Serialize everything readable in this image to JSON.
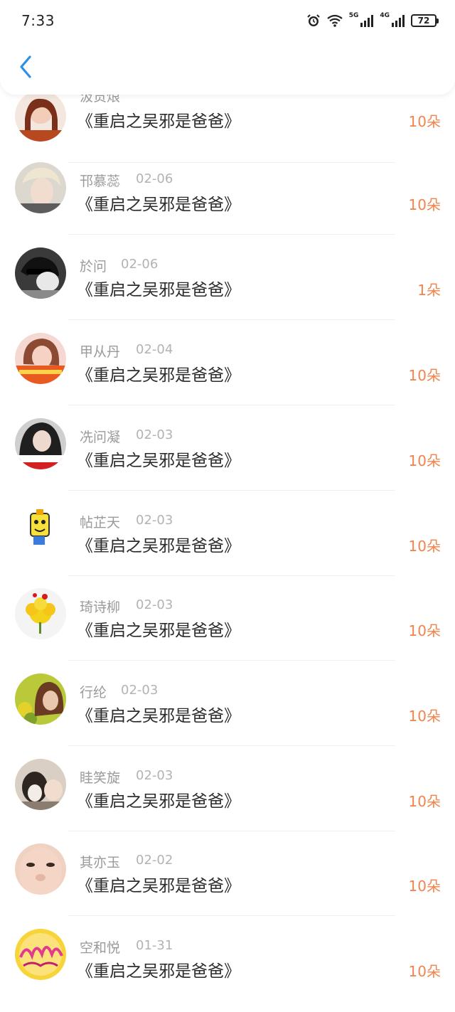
{
  "status_bar": {
    "time": "7:33",
    "network_5g": "5G",
    "network_4g": "4G",
    "battery": "72"
  },
  "nav": {
    "back_icon": "chevron-left-icon",
    "accent": "#2e8fe6"
  },
  "colors": {
    "flower_count": "#f2834a",
    "name": "#9a9a9a",
    "book": "#2b2b2b"
  },
  "rows": [
    {
      "name": "汲贡烺",
      "date": "",
      "book": "《重启之吴邪是爸爸》",
      "flowers": "10朵"
    },
    {
      "name": "邗慕蕊",
      "date": "02-06",
      "book": "《重启之吴邪是爸爸》",
      "flowers": "10朵"
    },
    {
      "name": "於问",
      "date": "02-06",
      "book": "《重启之吴邪是爸爸》",
      "flowers": "1朵"
    },
    {
      "name": "甲从丹",
      "date": "02-04",
      "book": "《重启之吴邪是爸爸》",
      "flowers": "10朵"
    },
    {
      "name": "冼问凝",
      "date": "02-03",
      "book": "《重启之吴邪是爸爸》",
      "flowers": "10朵"
    },
    {
      "name": "帖芷天",
      "date": "02-03",
      "book": "《重启之吴邪是爸爸》",
      "flowers": "10朵"
    },
    {
      "name": "琦诗柳",
      "date": "02-03",
      "book": "《重启之吴邪是爸爸》",
      "flowers": "10朵"
    },
    {
      "name": "行纶",
      "date": "02-03",
      "book": "《重启之吴邪是爸爸》",
      "flowers": "10朵"
    },
    {
      "name": "眭笑旋",
      "date": "02-03",
      "book": "《重启之吴邪是爸爸》",
      "flowers": "10朵"
    },
    {
      "name": "其亦玉",
      "date": "02-02",
      "book": "《重启之吴邪是爸爸》",
      "flowers": "10朵"
    },
    {
      "name": "空和悦",
      "date": "01-31",
      "book": "《重启之吴邪是爸爸》",
      "flowers": "10朵"
    }
  ]
}
